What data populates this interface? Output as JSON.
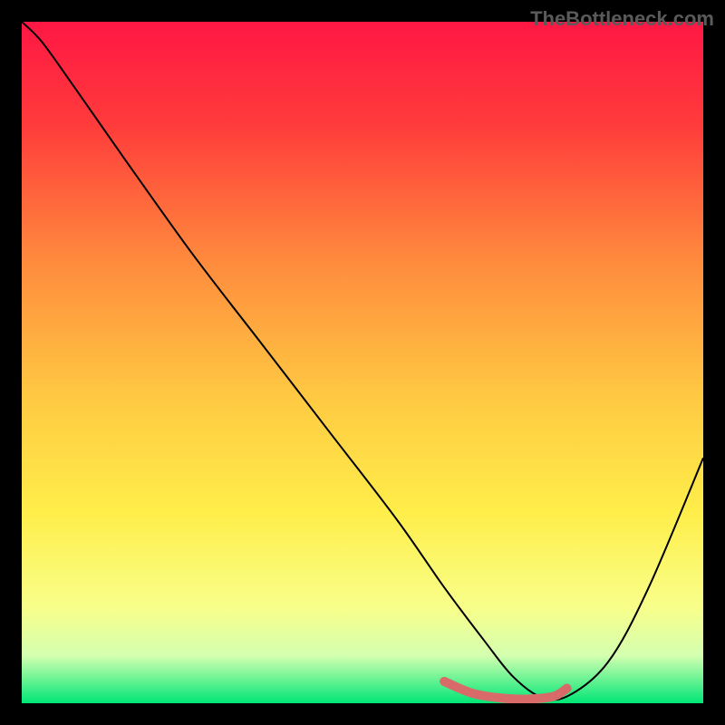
{
  "watermark": "TheBottleneck.com",
  "chart_data": {
    "type": "line",
    "title": "",
    "xlabel": "",
    "ylabel": "",
    "xlim": [
      0,
      100
    ],
    "ylim": [
      0,
      100
    ],
    "background_gradient": {
      "stops": [
        {
          "offset": 0,
          "color": "#ff1744"
        },
        {
          "offset": 15,
          "color": "#ff3b3b"
        },
        {
          "offset": 35,
          "color": "#ff8a3d"
        },
        {
          "offset": 55,
          "color": "#ffc942"
        },
        {
          "offset": 72,
          "color": "#ffee4a"
        },
        {
          "offset": 86,
          "color": "#f8ff8a"
        },
        {
          "offset": 93,
          "color": "#d4ffb0"
        },
        {
          "offset": 100,
          "color": "#00e676"
        }
      ]
    },
    "series": [
      {
        "name": "bottleneck-curve",
        "color": "#000000",
        "x": [
          0,
          3,
          8,
          15,
          25,
          35,
          45,
          55,
          62,
          68,
          72,
          76,
          80,
          86,
          92,
          100
        ],
        "y": [
          100,
          97,
          90,
          80,
          66,
          53,
          40,
          27,
          17,
          9,
          4,
          1,
          1,
          6,
          17,
          36
        ]
      }
    ],
    "highlight_segment": {
      "name": "optimal-range",
      "color": "#d96a6a",
      "x": [
        62,
        66,
        70,
        74,
        78,
        80
      ],
      "y": [
        3.2,
        1.5,
        0.8,
        0.6,
        1.0,
        2.2
      ]
    }
  }
}
